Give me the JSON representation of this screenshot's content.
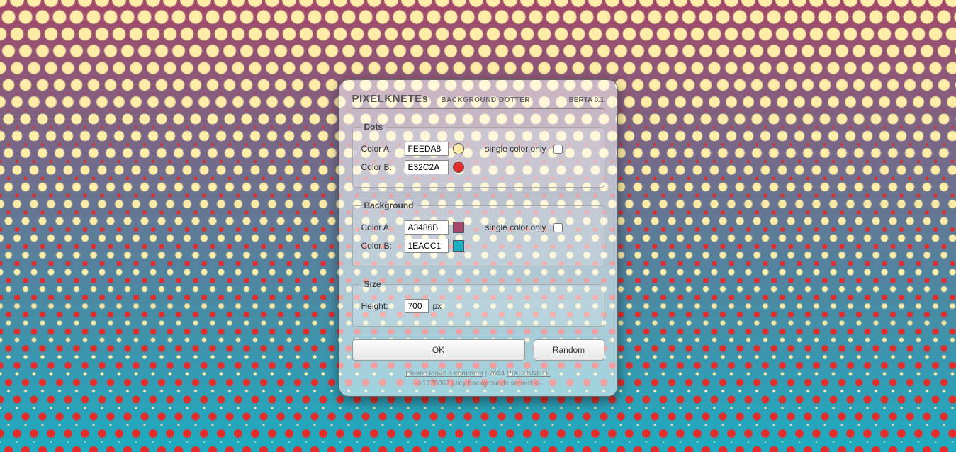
{
  "header": {
    "brand": "PIXELKNETEs",
    "subtitle": "BACKGROUND DOTTER",
    "version": "BERTA 0.1"
  },
  "dots": {
    "legend": "Dots",
    "labelA": "Color A:",
    "labelB": "Color B:",
    "colorA": "FEEDA8",
    "colorB": "E32C2A",
    "singleLabel": "single color only",
    "singleChecked": false
  },
  "background": {
    "legend": "Background",
    "labelA": "Color A:",
    "labelB": "Color B:",
    "colorA": "A3486B",
    "colorB": "1EACC1",
    "singleLabel": "single color only",
    "singleChecked": false
  },
  "size": {
    "legend": "Size",
    "heightLabel": "Height:",
    "height": "700",
    "unit": "px"
  },
  "buttons": {
    "ok": "OK",
    "random": "Random"
  },
  "footer": {
    "commentLink": "Please leave a comment",
    "sep": " | 2014 ",
    "siteLink": "PIXELKNETE",
    "served": "-->1776067 juicy backgrounds served <--"
  }
}
